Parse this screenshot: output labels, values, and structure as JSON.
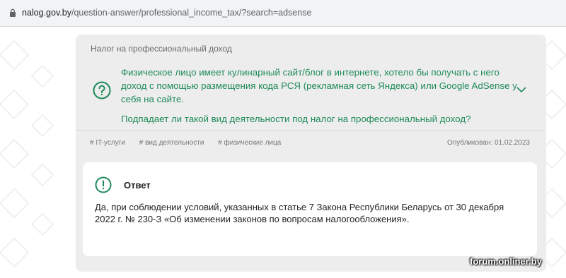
{
  "browser": {
    "url_host": "nalog.gov.by",
    "url_path": "/question-answer/professional_income_tax/?search=adsense"
  },
  "card": {
    "category": "Налог на профессиональный доход",
    "question_p1": "Физическое лицо имеет кулинарный сайт/блог в интернете, хотело бы получать с него доход с помощью размещения кода РСЯ (рекламная сеть Яндекса) или Google AdSense у себя на сайте.",
    "question_p2": "Подпадает ли такой вид деятельности под налог на профессиональный доход?",
    "tags": [
      "# IT-услуги",
      "# вид деятельности",
      "# физические лица"
    ],
    "published": "Опубликован: 01.02.2023"
  },
  "answer": {
    "title": "Ответ",
    "text": "Да, при соблюдении условий, указанных в статье 7 Закона Республики Беларусь от 30 декабря 2022 г. № 230-З «Об изменении законов по вопросам налогообложения»."
  },
  "watermark": "forum.onliner.by",
  "colors": {
    "accent": "#1e8a5a",
    "card_bg": "#ededed"
  },
  "icons": {
    "lock": "lock-icon",
    "question": "question-circle-icon",
    "expand": "chevron-down-icon",
    "answer": "exclamation-circle-icon"
  }
}
